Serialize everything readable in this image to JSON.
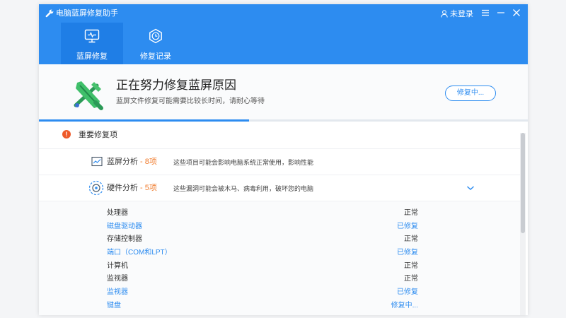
{
  "window": {
    "title": "电脑蓝屏修复助手"
  },
  "user": {
    "login_label": "未登录"
  },
  "tabs": [
    {
      "label": "蓝屏修复",
      "icon": "monitor-icon",
      "active": true
    },
    {
      "label": "修复记录",
      "icon": "clock-icon",
      "active": false
    }
  ],
  "status": {
    "title": "正在努力修复蓝屏原因",
    "subtitle": "蓝屏文件修复可能需要比较长时间，请耐心等待",
    "button_label": "修复中...",
    "progress": 0.43
  },
  "section": {
    "title": "重要修复项"
  },
  "rows": [
    {
      "name": "蓝屏分析",
      "sep": " - ",
      "count": "8项",
      "desc": "这些项目可能会影响电脑系统正常使用，影响性能",
      "icon": "chart-icon"
    },
    {
      "name": "硬件分析",
      "sep": " - ",
      "count": "5项",
      "desc": "这些漏洞可能会被木马、病毒利用，破坏您的电脑",
      "icon": "hardware-scan-icon"
    }
  ],
  "details": [
    {
      "name": "处理器",
      "status": "正常",
      "highlight": false
    },
    {
      "name": "磁盘驱动器",
      "status": "已修复",
      "highlight": true
    },
    {
      "name": "存储控制器",
      "status": "正常",
      "highlight": false
    },
    {
      "name": "端口（COM和LPT）",
      "status": "已修复",
      "highlight": true
    },
    {
      "name": "计算机",
      "status": "正常",
      "highlight": false
    },
    {
      "name": "监视器",
      "status": "正常",
      "highlight": false
    },
    {
      "name": "监视器",
      "status": "已修复",
      "highlight": true
    },
    {
      "name": "键盘",
      "status": "修复中...",
      "highlight": true
    }
  ],
  "colors": {
    "accent": "#2d8cf0",
    "warning": "#ee5a2a",
    "count": "#f07b2c"
  }
}
